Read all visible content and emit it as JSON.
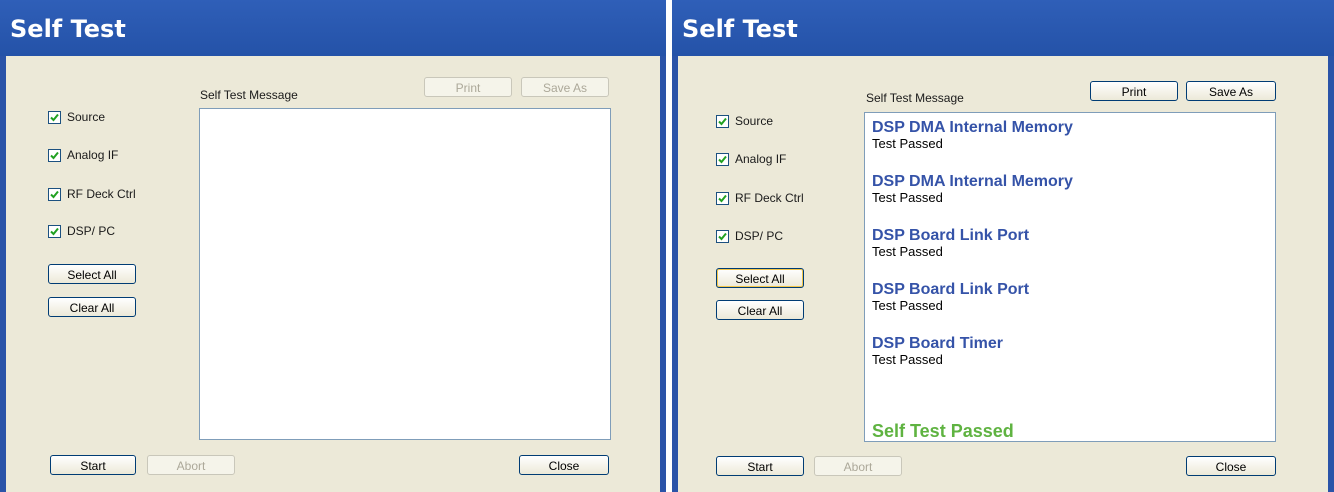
{
  "left": {
    "title": "Self Test",
    "checkboxes": [
      {
        "label": "Source",
        "checked": true
      },
      {
        "label": "Analog IF",
        "checked": true
      },
      {
        "label": "RF Deck Ctrl",
        "checked": true
      },
      {
        "label": "DSP/ PC",
        "checked": true
      }
    ],
    "select_all": "Select All",
    "clear_all": "Clear All",
    "message_label": "Self Test Message",
    "print": "Print",
    "save_as": "Save As",
    "start": "Start",
    "abort": "Abort",
    "close": "Close"
  },
  "right": {
    "title": "Self Test",
    "checkboxes": [
      {
        "label": "Source",
        "checked": true
      },
      {
        "label": "Analog IF",
        "checked": true
      },
      {
        "label": "RF Deck Ctrl",
        "checked": true
      },
      {
        "label": "DSP/ PC",
        "checked": true
      }
    ],
    "select_all": "Select All",
    "clear_all": "Clear All",
    "message_label": "Self Test Message",
    "print": "Print",
    "save_as": "Save As",
    "start": "Start",
    "abort": "Abort",
    "close": "Close",
    "messages": [
      {
        "title": "DSP DMA Internal Memory",
        "status": "Test Passed"
      },
      {
        "title": "DSP DMA Internal Memory",
        "status": "Test Passed"
      },
      {
        "title": "DSP Board Link Port",
        "status": "Test Passed"
      },
      {
        "title": "DSP Board Link Port",
        "status": "Test Passed"
      },
      {
        "title": "DSP Board Timer",
        "status": "Test Passed"
      }
    ],
    "final_message": "Self Test Passed"
  },
  "colors": {
    "title_bar": "#2452a8",
    "client_bg": "#ece9d8",
    "message_title": "#3553a8",
    "final_pass": "#5fb341"
  }
}
